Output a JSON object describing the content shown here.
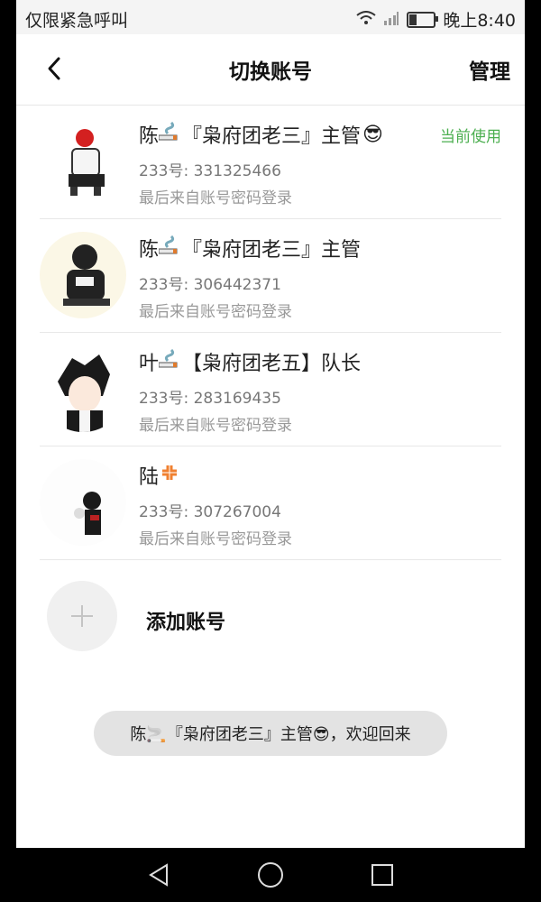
{
  "status": {
    "left_text": "仅限紧急呼叫",
    "time": "晚上8:40",
    "battery_level": 0.3
  },
  "header": {
    "title": "切换账号",
    "manage": "管理"
  },
  "accounts": [
    {
      "name": "陈",
      "group": "『枭府团老三』主管",
      "emoji": "😎",
      "uid": "233号: 331325466",
      "login": "最后来自账号密码登录",
      "current": "当前使用"
    },
    {
      "name": "陈",
      "group": "『枭府团老三』主管",
      "emoji": "",
      "uid": "233号: 306442371",
      "login": "最后来自账号密码登录",
      "current": ""
    },
    {
      "name": "叶",
      "group": "【枭府团老五】队长",
      "emoji": "",
      "uid": "233号: 283169435",
      "login": "最后来自账号密码登录",
      "current": ""
    },
    {
      "name": "陆",
      "group": "",
      "emoji": "💢",
      "uid": "233号: 307267004",
      "login": "最后来自账号密码登录",
      "current": ""
    }
  ],
  "add_account": {
    "label": "添加账号"
  },
  "toast": {
    "text": "陈🚬『枭府团老三』主管😎，欢迎回来"
  },
  "colors": {
    "accent": "#4caf50",
    "avatar_bg": [
      "#ffffff",
      "#fbf7e6",
      "#ffffff",
      "#fdfdfd"
    ]
  },
  "icons": {
    "back": "chevron-left-icon",
    "add": "plus-icon",
    "smoke": "cigarette-icon"
  }
}
